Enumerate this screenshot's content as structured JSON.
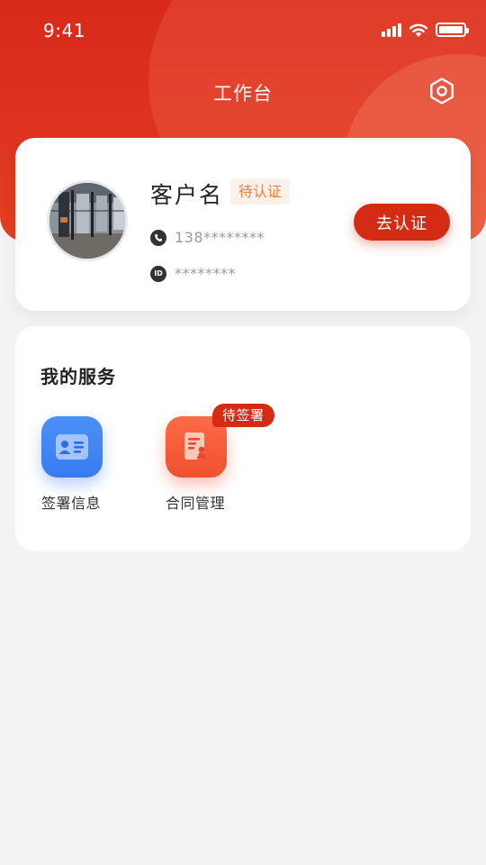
{
  "status_bar": {
    "time": "9:41"
  },
  "header": {
    "title": "工作台"
  },
  "profile": {
    "name": "客户名",
    "badge": "待认证",
    "phone": "138********",
    "id_label": "ID",
    "id_value": "********",
    "verify_button": "去认证"
  },
  "services": {
    "title": "我的服务",
    "items": [
      {
        "label": "签署信息",
        "icon": "id-card-icon"
      },
      {
        "label": "合同管理",
        "icon": "contract-icon",
        "badge": "待签署"
      }
    ]
  },
  "colors": {
    "brand_red": "#d42b14",
    "service_blue": "#3a7cf0",
    "service_orange": "#f0502d",
    "badge_text": "#e8803f",
    "page_bg": "#f2f3f5"
  }
}
